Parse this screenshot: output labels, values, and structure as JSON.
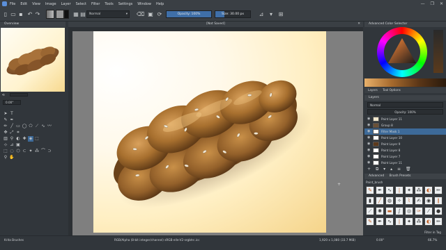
{
  "menubar": {
    "items": [
      "File",
      "Edit",
      "View",
      "Image",
      "Layer",
      "Select",
      "Filter",
      "Tools",
      "Settings",
      "Window",
      "Help"
    ]
  },
  "toolbar": {
    "blend_mode": "Normal",
    "opacity_label": "Opacity: 100%",
    "opacity_value": 1.0,
    "size_label": "Size: 30.00 px",
    "size_value": 0.25
  },
  "overview": {
    "title": "Overview"
  },
  "canvas": {
    "title": "[Not Saved]"
  },
  "toolbox": {
    "zoom_value": "0.00°"
  },
  "color_selector": {
    "title": "Advanced Color Selector"
  },
  "dock_tabs": [
    "Layers",
    "Tool Options"
  ],
  "layers": {
    "title": "Layers",
    "opacity_label": "Opacity: 100%",
    "blend": "Normal",
    "rows": [
      {
        "name": "Paint Layer 11",
        "thumb": "#f1e7cc"
      },
      {
        "name": "Group 8",
        "thumb": "#6b5036"
      },
      {
        "name": "Filter Mask 1",
        "thumb": "#ffffff"
      },
      {
        "name": "Paint Layer 10",
        "thumb": "#ffffff"
      },
      {
        "name": "Paint Layer 9",
        "thumb": "#5d3a1c"
      },
      {
        "name": "Paint Layer 8",
        "thumb": "#ffffff"
      },
      {
        "name": "Paint Layer 7",
        "thumb": "#ffffff"
      },
      {
        "name": "Paint Layer 11",
        "thumb": "#ffffff"
      }
    ],
    "selected_index": 2
  },
  "brush_presets": {
    "tabs": [
      "Advanced",
      "Brush Presets"
    ],
    "tag_value": "Paint_brush",
    "filter_label": "Filter in Tag"
  },
  "status": {
    "left": "Krita Brushes",
    "center": "RGB/Alpha (8-bit integer/channel)   sRGB-elle-V2-srgbtrc.icc",
    "dimensions": "1,920 x 1,080 (33.7 MiB)",
    "rotation": "0.00°",
    "zoom": "66.7%"
  },
  "colors": {
    "accent": "#3d6a99",
    "bread": "#8b5a2b",
    "background": "#31363b"
  }
}
